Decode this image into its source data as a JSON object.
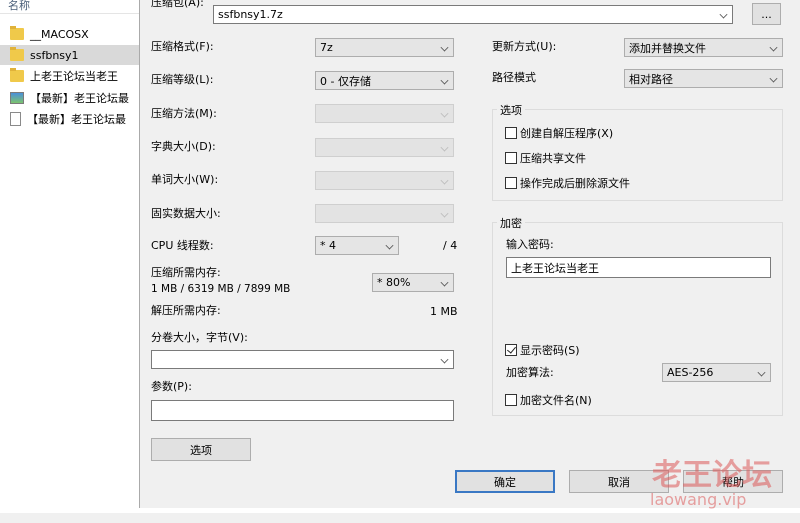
{
  "explorer": {
    "column_header": "名称",
    "items": [
      {
        "name": "__MACOSX",
        "icon": "folder-icon",
        "selected": false
      },
      {
        "name": "ssfbnsy1",
        "icon": "folder-icon",
        "selected": true
      },
      {
        "name": "上老王论坛当老王",
        "icon": "folder-icon",
        "selected": false
      },
      {
        "name": "【最新】老王论坛最",
        "icon": "image-file-icon",
        "selected": false
      },
      {
        "name": "【最新】老王论坛最",
        "icon": "text-file-icon",
        "selected": false
      }
    ]
  },
  "dialog": {
    "archive_label": "压缩包(A):",
    "archive_value": "ssfbnsy1.7z",
    "browse_label": "...",
    "format_label": "压缩格式(F):",
    "format_value": "7z",
    "level_label": "压缩等级(L):",
    "level_value": "0 - 仅存储",
    "method_label": "压缩方法(M):",
    "dict_label": "字典大小(D):",
    "word_label": "单词大小(W):",
    "solid_label": "固实数据大小:",
    "cpu_label": "CPU 线程数:",
    "cpu_value": "* 4",
    "cpu_max": "/ 4",
    "mem_comp_label": "压缩所需内存:",
    "mem_comp_value": "1 MB / 6319 MB / 7899 MB",
    "mem_pct_value": "* 80%",
    "mem_decomp_label": "解压所需内存:",
    "mem_decomp_value": "1 MB",
    "volume_label": "分卷大小，字节(V):",
    "volume_value": "",
    "params_label": "参数(P):",
    "params_value": "",
    "options_btn": "选项",
    "update_label": "更新方式(U):",
    "update_value": "添加并替换文件",
    "path_label": "路径模式",
    "path_value": "相对路径",
    "options_group": "选项",
    "opt_sfx": "创建自解压程序(X)",
    "opt_shared": "压缩共享文件",
    "opt_delete": "操作完成后删除源文件",
    "enc_group": "加密",
    "enc_pwd_label": "输入密码:",
    "enc_pwd_value": "上老王论坛当老王",
    "show_pwd": "显示密码(S)",
    "enc_method_label": "加密算法:",
    "enc_method_value": "AES-256",
    "enc_names": "加密文件名(N)",
    "ok": "确定",
    "cancel": "取消",
    "help": "帮助"
  },
  "watermark": {
    "cn": "老王论坛",
    "en": "laowang.vip"
  }
}
